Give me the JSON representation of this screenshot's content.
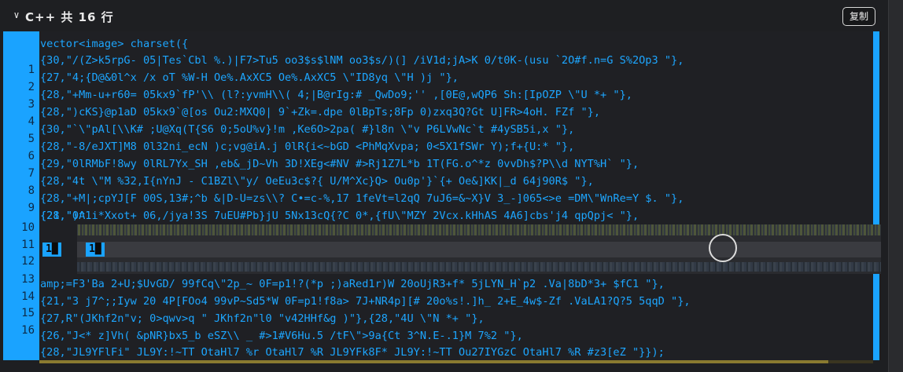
{
  "header": {
    "title": "C++ 共 16 行",
    "copy_label": "复制",
    "chevron_icon": "chevron-down-icon"
  },
  "gutter": {
    "line_numbers": [
      "1",
      "2",
      "3",
      "4",
      "5",
      "6",
      "7",
      "8",
      "9",
      "10",
      "11",
      "12",
      "13",
      "14",
      "15",
      "16"
    ]
  },
  "code": {
    "lines": [
      "vector<image> charset({",
      "{30,\"/(Z>k5rpG- 05|Tes`Cbl %.)|F7>Tu5 oo3$s$lNM oo3$s/)(] /iV1d;jA>K 0/t0K-(usu `2O#f.n=G S%2Op3 \"},",
      "{27,\"4;{D@&0l^x /x oT %W-H Oe%.AxXC5 Oe%.AxXC5 \\\"ID8yq \\\"H )j \"},",
      "{28,\"+Mm-u+r60= 05kx9`fP'\\\\ (l?:yvmH\\\\( 4;|B@rIg:# _QwDo9;'' ,[0E@,wQP6 Sh:[IpOZP \\\"U *+ \"},",
      "{28,\")cKS}@p1aD 05kx9`@[os Ou2:MXQ0| 9`+Zk=.dpe 0lBpTs;8Fp 0)zxq3Q?Gt U]FR>4oH. FZf \"},",
      "{30,\"`\\\"pAl[\\\\K# ;U@Xq(T{S6 0;5oU%v}!m ,Ke6O>2pa( #}l8n \\\"v P6LVwNc`t #4ySB5i,x \"},",
      "{28,\"-8/eJXT]M8 0l32ni_ecN )c;vg@iA.j 0lR{i<~bGD <PhMqXvpa; 0<5X1fSWr Y);f+{U:* \"},",
      "{29,\"0lRMbF!8wy 0lRL7Yx_SH ,eb&_jD~Vh 3D!XEg<#NV #>Rj1Z7L*b 1T(FG.o^*z 0vvDh$?P\\\\d NYT%H` \"},",
      "{28,\"4t \\\"M %32,I{nYnJ - C1BZl\\\"y/ OeEu3c$?{ U/M^Xc}Q> Ou0p'}`{+ Oe&]KK|_d 64j90R$ \"},",
      "{28,\"+M|;cpYJ[F 00S,13#;^b &|D-U=zs\\\\? C•=c-%,17 1feVt=l2qQ 7uJ6=&~X}V 3_-]065<>e =DM\\\"WnRe=Y $. \"},",
      "{28,\")^1i*Xxot+ 06,/jya!3S 7uEU#Pb}jU 5Nx13cQ{?C 0*,{fU\\\"MZY 2Vcx.kHhAS 4A6]cbs'j4 qpQpj< \"},",
      "{21,\"0A",
      "amp;=F3'Ba 2+U;$UvGD/ 99fCq\\\"2p_~ 0F=p1!?(*p ;)aRed1r)W 20oUjR3+f* 5jLYN_H`p2 .Va|8bD*3+ $fC1 \"},",
      "{21,\"3 j7^;;Iyw 20 4P[FOo4 99vP~Sd5*W 0F=p1!f8a> 7J+NR4p][# 20o%s!.]h_ 2+E_4w$-Zf .VaLA1?Q?5 5qqD \"},",
      "{27,R\"(JKhf2n\"v; 0>qwv>q \" JKhf2n\"l0 \"v42HHf&g )\"},{28,\"4U \\\"N *+ \"},",
      "{26,\"J<* z]Vh( &pNR}bx5_b eSZ\\\\ _ #>1#V6Hu.5 /tF\\\">9a{Ct 3^N.E-.1}M 7%2 \"},",
      "{28,\"JL9YFlFi\" JL9Y:!~TT OtaHl7 %r OtaHl7 %R JL9YFk8F* JL9Y:!~TT Ou27IYGzC OtaHl7 %R #z3[eZ \"}});"
    ],
    "glitch_chip_a": "1█",
    "glitch_chip_b": "1█"
  },
  "colors": {
    "accent": "#1aa3ff",
    "panel_bg": "#1e1f22",
    "code_text": "#1da6ff"
  }
}
